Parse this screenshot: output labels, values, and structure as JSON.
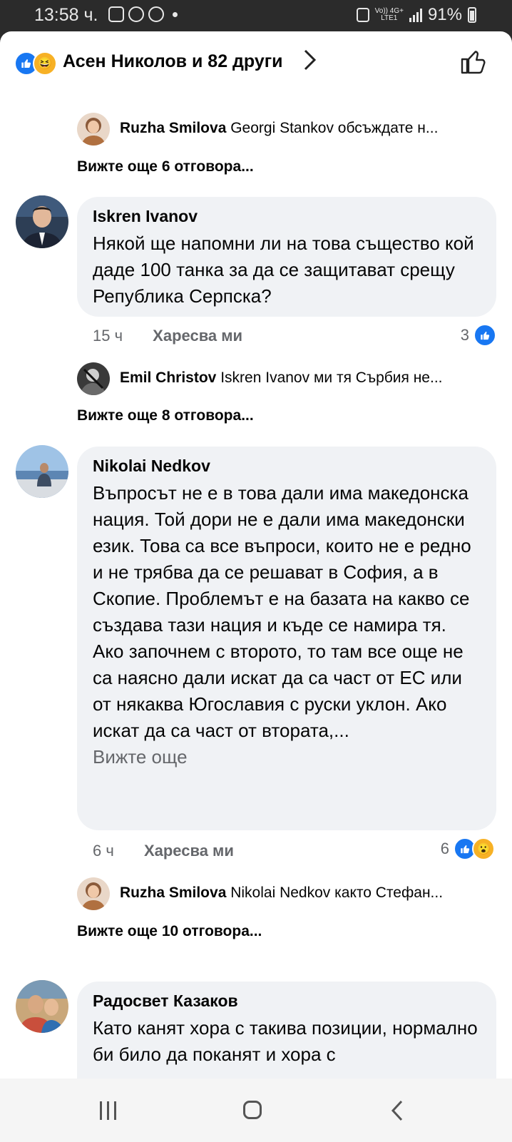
{
  "status_bar": {
    "time": "13:58 ч.",
    "network_top": "Vo)) 4G+",
    "network_bottom": "LTE1",
    "battery": "91%"
  },
  "header": {
    "reactors_text": "Асен Николов и 82 други"
  },
  "threads": [
    {
      "reply_preview": {
        "author": "Ruzha Smilova",
        "text": "Georgi Stankov обсъждате н..."
      },
      "more_replies": "Вижте още 6 отговора..."
    },
    {
      "comment": {
        "author": "Iskren Ivanov",
        "text": "Някой ще напомни ли на това същество кой даде 100 танка за да се защитават срещу Република Серпска?",
        "time": "15 ч",
        "like_label": "Харесва ми",
        "reaction_count": "3"
      },
      "reply_preview": {
        "author": "Emil Christov",
        "text": "Iskren Ivanov ми тя Сърбия не..."
      },
      "more_replies": "Вижте още 8 отговора..."
    },
    {
      "comment": {
        "author": "Nikolai Nedkov",
        "text": "Въпросът не е в това дали има македонска нация. Той дори не е дали има македонски език. Това са все въпроси, които не е редно и не трябва да се решават в София, а в Скопие. Проблемът е на базата на какво се създава тази нация и къде се намира тя. Ако започнем с второто, то там все още не са наясно дали искат да са част от ЕС или от някаква Югославия с руски уклон. Ако искат да са част от втората,...",
        "see_more": "Вижте още",
        "time": "6 ч",
        "like_label": "Харесва ми",
        "reaction_count": "6"
      },
      "reply_preview": {
        "author": "Ruzha Smilova",
        "text": "Nikolai Nedkov както Стефан..."
      },
      "more_replies": "Вижте още 10 отговора..."
    },
    {
      "comment": {
        "author": "Радосвет Казаков",
        "text": "Като канят хора с такива позиции, нормално би било да поканят и хора с"
      }
    }
  ],
  "colors": {
    "like_blue": "#1877f2",
    "bubble_bg": "#f0f2f5",
    "meta_gray": "#65676b",
    "status_bar_bg": "#2b2b2b"
  },
  "icons": [
    "like-icon",
    "haha-icon",
    "wow-icon",
    "thumbs-up-icon",
    "chevron-right-icon",
    "recent-apps-icon",
    "home-icon",
    "back-icon"
  ]
}
